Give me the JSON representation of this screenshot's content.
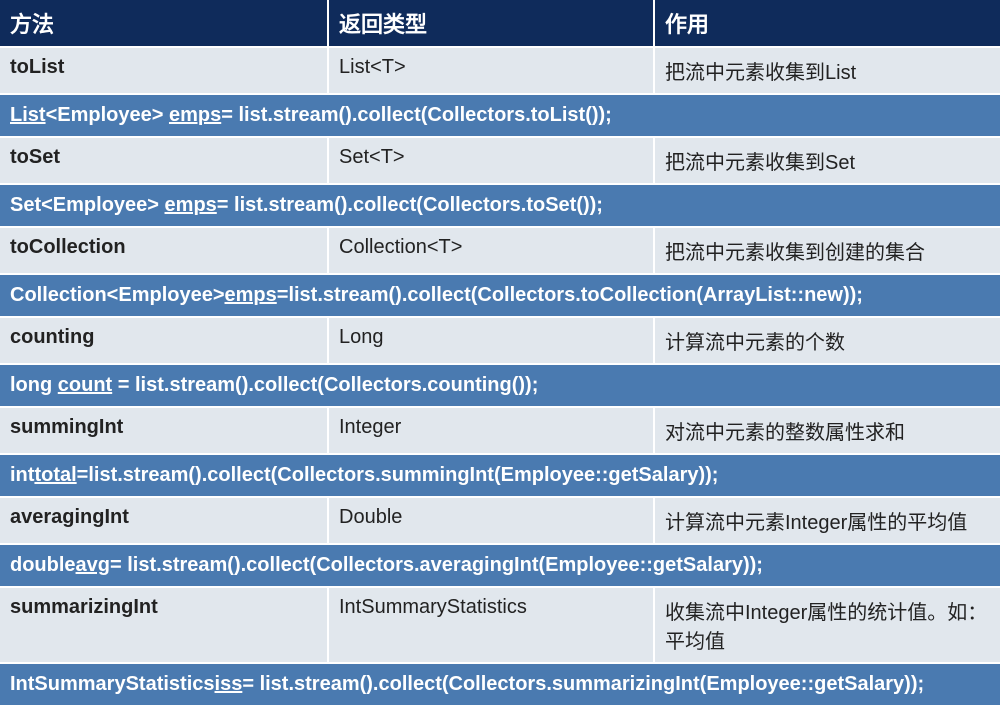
{
  "headers": [
    "方法",
    "返回类型",
    "作用"
  ],
  "rows": [
    {
      "type": "data",
      "cells": [
        "toList",
        "List<T>",
        "把流中元素收集到List"
      ]
    },
    {
      "type": "code",
      "segments": [
        {
          "t": "List",
          "u": true
        },
        {
          "t": "<Employee> "
        },
        {
          "t": "emps",
          "u": true
        },
        {
          "t": "= list.stream().collect(Collectors.toList());"
        }
      ]
    },
    {
      "type": "data",
      "cells": [
        "toSet",
        "Set<T>",
        "把流中元素收集到Set"
      ]
    },
    {
      "type": "code",
      "segments": [
        {
          "t": "Set<Employee> "
        },
        {
          "t": "emps",
          "u": true
        },
        {
          "t": "= list.stream().collect(Collectors.toSet());"
        }
      ]
    },
    {
      "type": "data",
      "cells": [
        "toCollection",
        "Collection<T>",
        "把流中元素收集到创建的集合"
      ]
    },
    {
      "type": "code",
      "segments": [
        {
          "t": "Collection<Employee>"
        },
        {
          "t": "emps",
          "u": true
        },
        {
          "t": "=list.stream().collect(Collectors.toCollection(ArrayList::new));"
        }
      ]
    },
    {
      "type": "data",
      "cells": [
        "counting",
        "Long",
        "计算流中元素的个数"
      ]
    },
    {
      "type": "code",
      "segments": [
        {
          "t": "long "
        },
        {
          "t": "count",
          "u": true
        },
        {
          "t": " = list.stream().collect(Collectors.counting());"
        }
      ]
    },
    {
      "type": "data",
      "cells": [
        "summingInt",
        "Integer",
        "对流中元素的整数属性求和"
      ]
    },
    {
      "type": "code",
      "segments": [
        {
          "t": "int"
        },
        {
          "t": "total",
          "u": true
        },
        {
          "t": "=list.stream().collect(Collectors.summingInt(Employee::getSalary));"
        }
      ]
    },
    {
      "type": "data",
      "cells": [
        "averagingInt",
        "Double",
        "计算流中元素Integer属性的平均值"
      ]
    },
    {
      "type": "code",
      "segments": [
        {
          "t": "double"
        },
        {
          "t": "avg",
          "u": true
        },
        {
          "t": "= list.stream().collect(Collectors.averagingInt(Employee::getSalary));"
        }
      ]
    },
    {
      "type": "data",
      "cells": [
        "summarizingInt",
        "IntSummaryStatistics",
        "收集流中Integer属性的统计值。如：平均值"
      ]
    },
    {
      "type": "code",
      "segments": [
        {
          "t": "IntSummaryStatistics"
        },
        {
          "t": "iss",
          "u": true
        },
        {
          "t": "= list.stream().collect(Collectors.summarizingInt(Employee::getSalary));"
        }
      ]
    }
  ]
}
